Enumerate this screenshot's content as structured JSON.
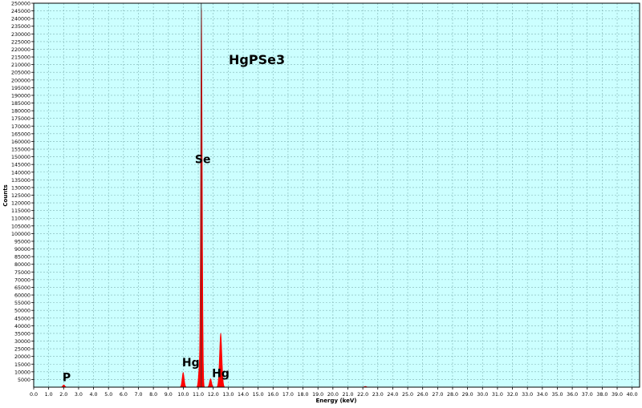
{
  "chart_data": {
    "type": "area",
    "title": "HgPSe3",
    "xlabel": "Energy (keV)",
    "ylabel": "Counts",
    "xlim": [
      0,
      40.5
    ],
    "ylim": [
      0,
      250000
    ],
    "grid": true,
    "x_ticks": [
      0.0,
      1.0,
      2.0,
      3.0,
      4.0,
      5.0,
      6.0,
      7.0,
      8.0,
      9.0,
      10.0,
      11.0,
      12.0,
      13.0,
      14.0,
      15.0,
      16.0,
      17.0,
      18.0,
      19.0,
      20.0,
      21.0,
      22.0,
      23.0,
      24.0,
      25.0,
      26.0,
      27.0,
      28.0,
      29.0,
      30.0,
      31.0,
      32.0,
      33.0,
      34.0,
      35.0,
      36.0,
      37.0,
      38.0,
      39.0,
      40.0
    ],
    "y_tick_step": 5000,
    "series": [
      {
        "color": "#ff0000",
        "peaks": [
          {
            "x": 2.01,
            "height": 1500,
            "width": 0.07
          },
          {
            "x": 9.99,
            "height": 9500,
            "width": 0.07
          },
          {
            "x": 11.07,
            "height": 12000,
            "width": 0.06
          },
          {
            "x": 11.21,
            "height": 245000,
            "width": 0.05
          },
          {
            "x": 11.29,
            "height": 20000,
            "width": 0.04
          },
          {
            "x": 11.82,
            "height": 5500,
            "width": 0.07
          },
          {
            "x": 12.5,
            "height": 35000,
            "width": 0.08
          },
          {
            "x": 22.17,
            "height": 500,
            "width": 0.08
          }
        ]
      }
    ],
    "annotations": [
      {
        "text": "P",
        "x": 2.2,
        "y": 4000
      },
      {
        "text": "Hg",
        "x": 10.5,
        "y": 13500
      },
      {
        "text": "Hg",
        "x": 12.5,
        "y": 6500
      },
      {
        "text": "Se",
        "x": 11.3,
        "y": 146000
      }
    ]
  }
}
